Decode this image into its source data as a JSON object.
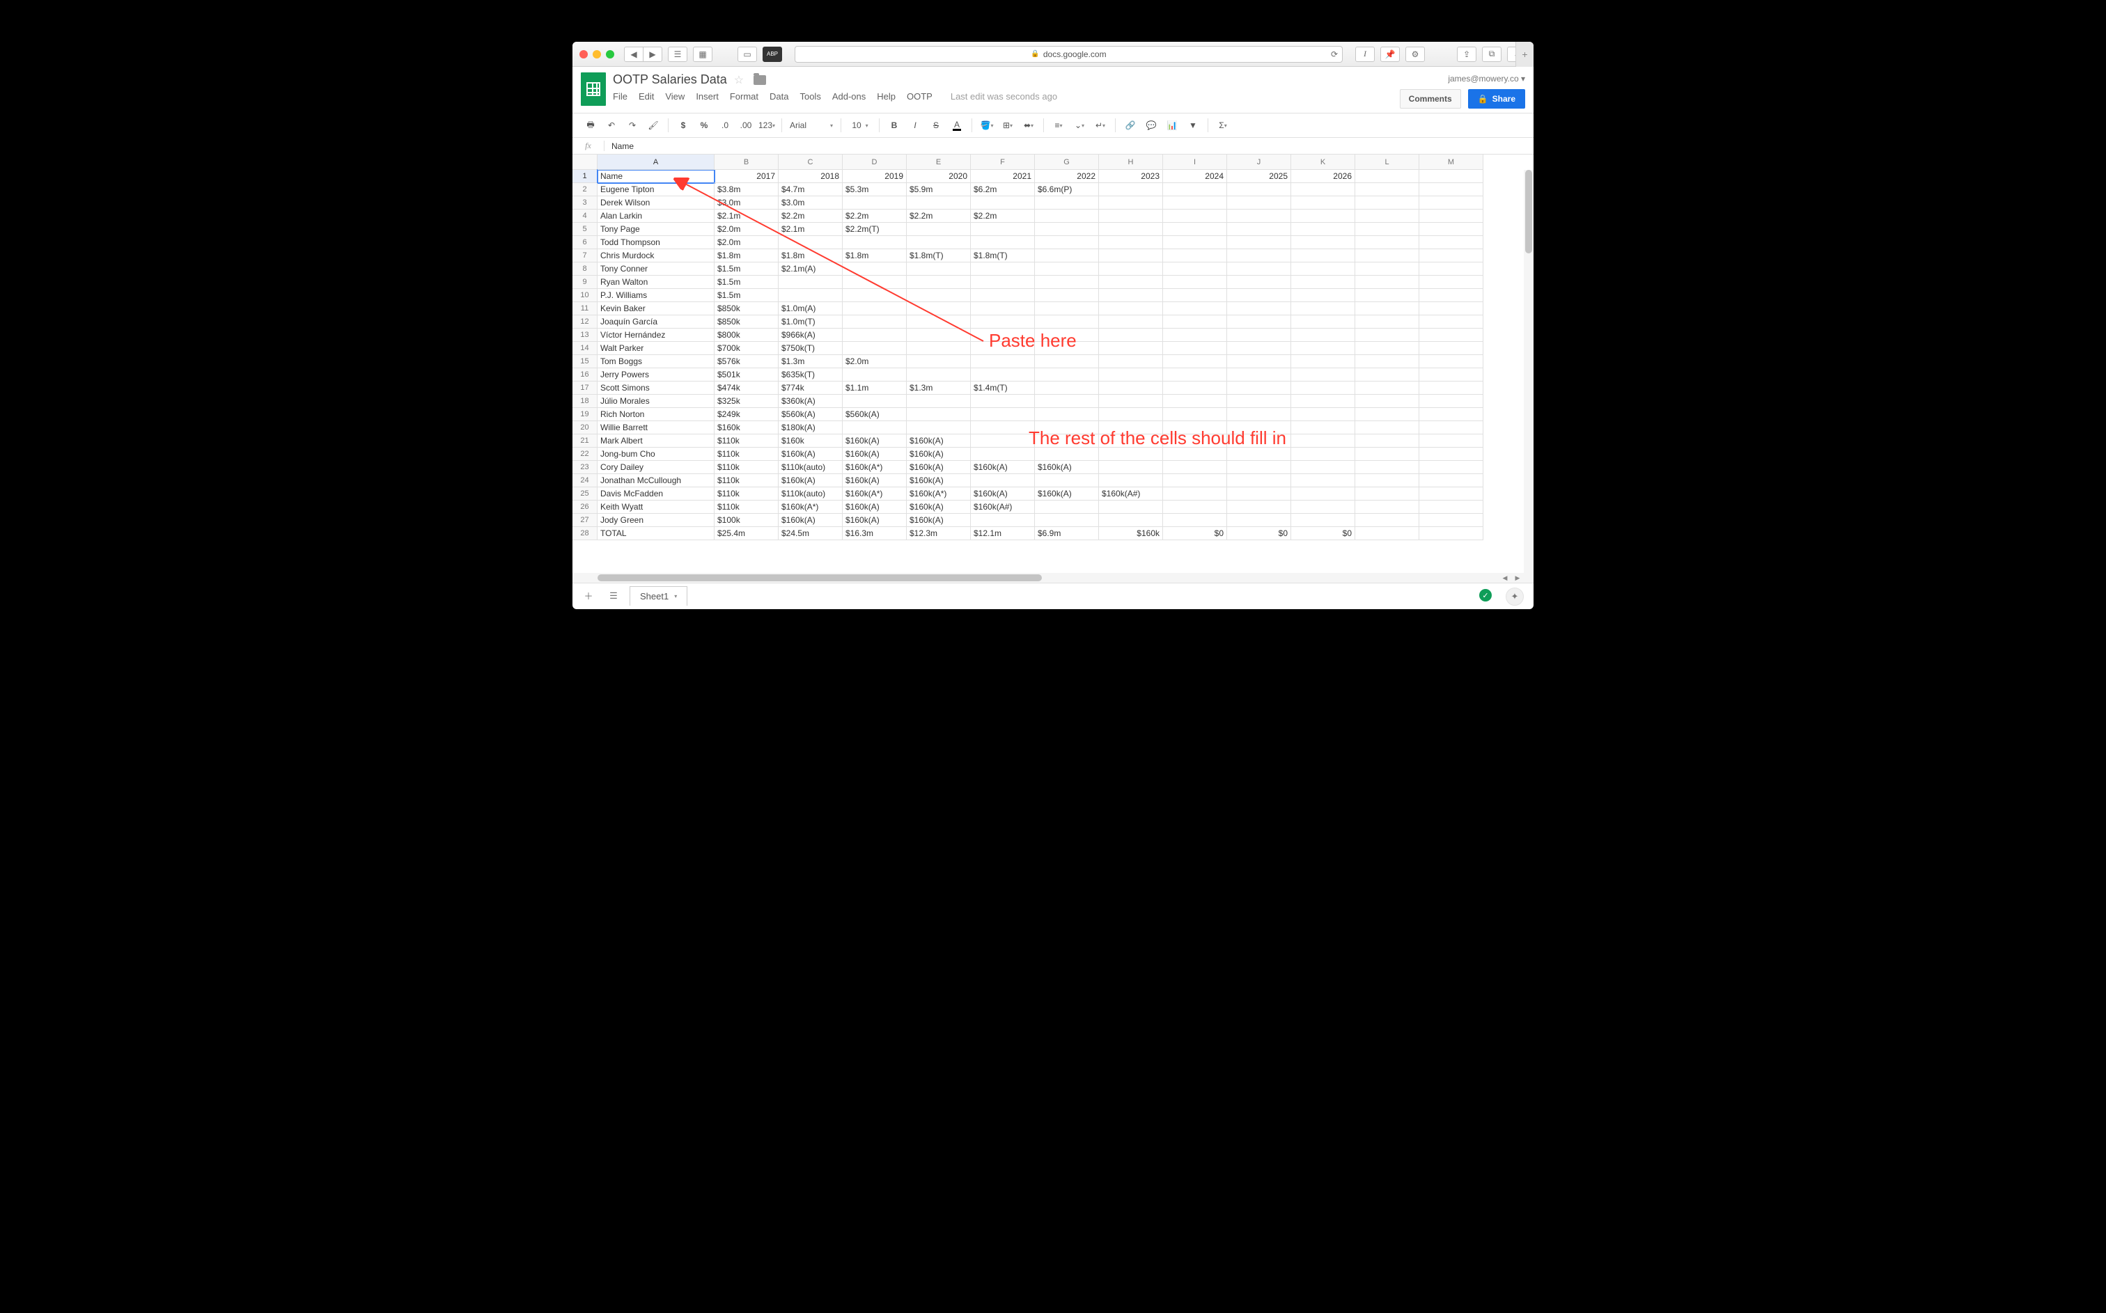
{
  "browser": {
    "url_host": "docs.google.com",
    "secure": true
  },
  "doc": {
    "title": "OOTP Salaries Data",
    "last_edit": "Last edit was seconds ago",
    "user_email": "james@mowery.co"
  },
  "menubar": [
    "File",
    "Edit",
    "View",
    "Insert",
    "Format",
    "Data",
    "Tools",
    "Add-ons",
    "Help",
    "OOTP"
  ],
  "buttons": {
    "comments": "Comments",
    "share": "Share"
  },
  "toolbar": {
    "font": "Arial",
    "font_size": "10"
  },
  "formula": {
    "fx": "fx",
    "value": "Name"
  },
  "columns": [
    "A",
    "B",
    "C",
    "D",
    "E",
    "F",
    "G",
    "H",
    "I",
    "J",
    "K",
    "L",
    "M"
  ],
  "rows": [
    {
      "n": 1,
      "cells": [
        "Name",
        "2017",
        "2018",
        "2019",
        "2020",
        "2021",
        "2022",
        "2023",
        "2024",
        "2025",
        "2026",
        "",
        ""
      ],
      "numeric_from": 1
    },
    {
      "n": 2,
      "cells": [
        "Eugene Tipton",
        "$3.8m",
        "$4.7m",
        "$5.3m",
        "$5.9m",
        "$6.2m",
        "$6.6m(P)",
        "",
        "",
        "",
        "",
        "",
        ""
      ],
      "numeric_from": 99
    },
    {
      "n": 3,
      "cells": [
        "Derek Wilson",
        "$3.0m",
        "$3.0m",
        "",
        "",
        "",
        "",
        "",
        "",
        "",
        "",
        "",
        ""
      ],
      "numeric_from": 99
    },
    {
      "n": 4,
      "cells": [
        "Alan Larkin",
        "$2.1m",
        "$2.2m",
        "$2.2m",
        "$2.2m",
        "$2.2m",
        "",
        "",
        "",
        "",
        "",
        "",
        ""
      ],
      "numeric_from": 99
    },
    {
      "n": 5,
      "cells": [
        "Tony Page",
        "$2.0m",
        "$2.1m",
        "$2.2m(T)",
        "",
        "",
        "",
        "",
        "",
        "",
        "",
        "",
        ""
      ],
      "numeric_from": 99
    },
    {
      "n": 6,
      "cells": [
        "Todd Thompson",
        "$2.0m",
        "",
        "",
        "",
        "",
        "",
        "",
        "",
        "",
        "",
        "",
        ""
      ],
      "numeric_from": 99
    },
    {
      "n": 7,
      "cells": [
        "Chris Murdock",
        "$1.8m",
        "$1.8m",
        "$1.8m",
        "$1.8m(T)",
        "$1.8m(T)",
        "",
        "",
        "",
        "",
        "",
        "",
        ""
      ],
      "numeric_from": 99
    },
    {
      "n": 8,
      "cells": [
        "Tony Conner",
        "$1.5m",
        "$2.1m(A)",
        "",
        "",
        "",
        "",
        "",
        "",
        "",
        "",
        "",
        ""
      ],
      "numeric_from": 99
    },
    {
      "n": 9,
      "cells": [
        "Ryan Walton",
        "$1.5m",
        "",
        "",
        "",
        "",
        "",
        "",
        "",
        "",
        "",
        "",
        ""
      ],
      "numeric_from": 99
    },
    {
      "n": 10,
      "cells": [
        "P.J. Williams",
        "$1.5m",
        "",
        "",
        "",
        "",
        "",
        "",
        "",
        "",
        "",
        "",
        ""
      ],
      "numeric_from": 99
    },
    {
      "n": 11,
      "cells": [
        "Kevin Baker",
        "$850k",
        "$1.0m(A)",
        "",
        "",
        "",
        "",
        "",
        "",
        "",
        "",
        "",
        ""
      ],
      "numeric_from": 99
    },
    {
      "n": 12,
      "cells": [
        "Joaquín García",
        "$850k",
        "$1.0m(T)",
        "",
        "",
        "",
        "",
        "",
        "",
        "",
        "",
        "",
        ""
      ],
      "numeric_from": 99
    },
    {
      "n": 13,
      "cells": [
        "Víctor Hernández",
        "$800k",
        "$966k(A)",
        "",
        "",
        "",
        "",
        "",
        "",
        "",
        "",
        "",
        ""
      ],
      "numeric_from": 99
    },
    {
      "n": 14,
      "cells": [
        "Walt Parker",
        "$700k",
        "$750k(T)",
        "",
        "",
        "",
        "",
        "",
        "",
        "",
        "",
        "",
        ""
      ],
      "numeric_from": 99
    },
    {
      "n": 15,
      "cells": [
        "Tom Boggs",
        "$576k",
        "$1.3m",
        "$2.0m",
        "",
        "",
        "",
        "",
        "",
        "",
        "",
        "",
        ""
      ],
      "numeric_from": 99
    },
    {
      "n": 16,
      "cells": [
        "Jerry Powers",
        "$501k",
        "$635k(T)",
        "",
        "",
        "",
        "",
        "",
        "",
        "",
        "",
        "",
        ""
      ],
      "numeric_from": 99
    },
    {
      "n": 17,
      "cells": [
        "Scott Simons",
        "$474k",
        "$774k",
        "$1.1m",
        "$1.3m",
        "$1.4m(T)",
        "",
        "",
        "",
        "",
        "",
        "",
        ""
      ],
      "numeric_from": 99
    },
    {
      "n": 18,
      "cells": [
        "Júlio Morales",
        "$325k",
        "$360k(A)",
        "",
        "",
        "",
        "",
        "",
        "",
        "",
        "",
        "",
        ""
      ],
      "numeric_from": 99
    },
    {
      "n": 19,
      "cells": [
        "Rich Norton",
        "$249k",
        "$560k(A)",
        "$560k(A)",
        "",
        "",
        "",
        "",
        "",
        "",
        "",
        "",
        ""
      ],
      "numeric_from": 99
    },
    {
      "n": 20,
      "cells": [
        "Willie Barrett",
        "$160k",
        "$180k(A)",
        "",
        "",
        "",
        "",
        "",
        "",
        "",
        "",
        "",
        ""
      ],
      "numeric_from": 99
    },
    {
      "n": 21,
      "cells": [
        "Mark Albert",
        "$110k",
        "$160k",
        "$160k(A)",
        "$160k(A)",
        "",
        "",
        "",
        "",
        "",
        "",
        "",
        ""
      ],
      "numeric_from": 99
    },
    {
      "n": 22,
      "cells": [
        "Jong-bum Cho",
        "$110k",
        "$160k(A)",
        "$160k(A)",
        "$160k(A)",
        "",
        "",
        "",
        "",
        "",
        "",
        "",
        ""
      ],
      "numeric_from": 99
    },
    {
      "n": 23,
      "cells": [
        "Cory Dailey",
        "$110k",
        "$110k(auto)",
        "$160k(A*)",
        "$160k(A)",
        "$160k(A)",
        "$160k(A)",
        "",
        "",
        "",
        "",
        "",
        ""
      ],
      "numeric_from": 99
    },
    {
      "n": 24,
      "cells": [
        "Jonathan McCullough",
        "$110k",
        "$160k(A)",
        "$160k(A)",
        "$160k(A)",
        "",
        "",
        "",
        "",
        "",
        "",
        "",
        ""
      ],
      "numeric_from": 99
    },
    {
      "n": 25,
      "cells": [
        "Davis McFadden",
        "$110k",
        "$110k(auto)",
        "$160k(A*)",
        "$160k(A*)",
        "$160k(A)",
        "$160k(A)",
        "$160k(A#)",
        "",
        "",
        "",
        "",
        ""
      ],
      "numeric_from": 99
    },
    {
      "n": 26,
      "cells": [
        "Keith Wyatt",
        "$110k",
        "$160k(A*)",
        "$160k(A)",
        "$160k(A)",
        "$160k(A#)",
        "",
        "",
        "",
        "",
        "",
        "",
        ""
      ],
      "numeric_from": 99
    },
    {
      "n": 27,
      "cells": [
        "Jody Green",
        "$100k",
        "$160k(A)",
        "$160k(A)",
        "$160k(A)",
        "",
        "",
        "",
        "",
        "",
        "",
        "",
        ""
      ],
      "numeric_from": 99
    },
    {
      "n": 28,
      "cells": [
        "TOTAL",
        "$25.4m",
        "$24.5m",
        "$16.3m",
        "$12.3m",
        "$12.1m",
        "$6.9m",
        "$160k",
        "$0",
        "$0",
        "$0",
        "",
        ""
      ],
      "numeric_from": 7
    }
  ],
  "annotations": {
    "paste_here": "Paste here",
    "fill_in": "The rest of the cells should fill in"
  },
  "sheet_tab": "Sheet1",
  "selected_cell": {
    "row": 1,
    "col": 0
  }
}
